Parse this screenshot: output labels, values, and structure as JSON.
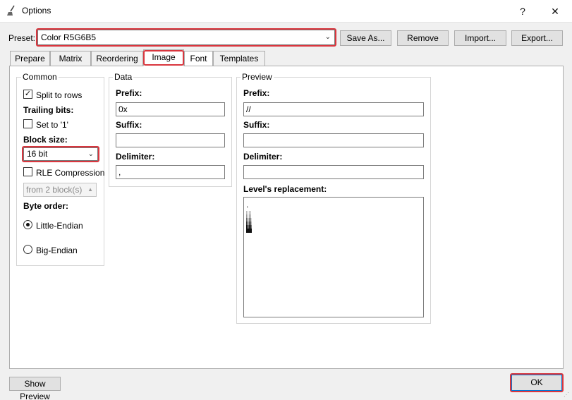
{
  "window": {
    "title": "Options",
    "help_glyph": "?",
    "close_glyph": "✕"
  },
  "preset": {
    "label": "Preset:",
    "value": "Color R5G6B5",
    "save_as": "Save As...",
    "remove": "Remove",
    "import": "Import...",
    "export": "Export..."
  },
  "tabs": [
    "Prepare",
    "Matrix",
    "Reordering",
    "Image",
    "Font",
    "Templates"
  ],
  "active_tab": "Image",
  "common": {
    "title": "Common",
    "split_rows": "Split to rows",
    "split_rows_checked": true,
    "trailing_bits": "Trailing bits:",
    "set_to_1": "Set to '1'",
    "set_to_1_checked": false,
    "block_size_label": "Block size:",
    "block_size_value": "16 bit",
    "rle": "RLE Compression",
    "rle_checked": false,
    "rle_from": "from 2 block(s)",
    "byte_order": "Byte order:",
    "little_endian": "Little-Endian",
    "big_endian": "Big-Endian",
    "selected_byte_order": "Little-Endian"
  },
  "data_group": {
    "title": "Data",
    "prefix_label": "Prefix:",
    "prefix_value": "0x",
    "suffix_label": "Suffix:",
    "suffix_value": "",
    "delimiter_label": "Delimiter:",
    "delimiter_value": ","
  },
  "preview_group": {
    "title": "Preview",
    "prefix_label": "Prefix:",
    "prefix_value": "//",
    "suffix_label": "Suffix:",
    "suffix_value": "",
    "delimiter_label": "Delimiter:",
    "delimiter_value": "",
    "levels_label": "Level's replacement:",
    "levels_text": "."
  },
  "footer": {
    "show_preview": "Show Preview",
    "ok": "OK"
  },
  "colors": {
    "highlight": "#d9363e",
    "window_bg": "#f0f0f0"
  }
}
